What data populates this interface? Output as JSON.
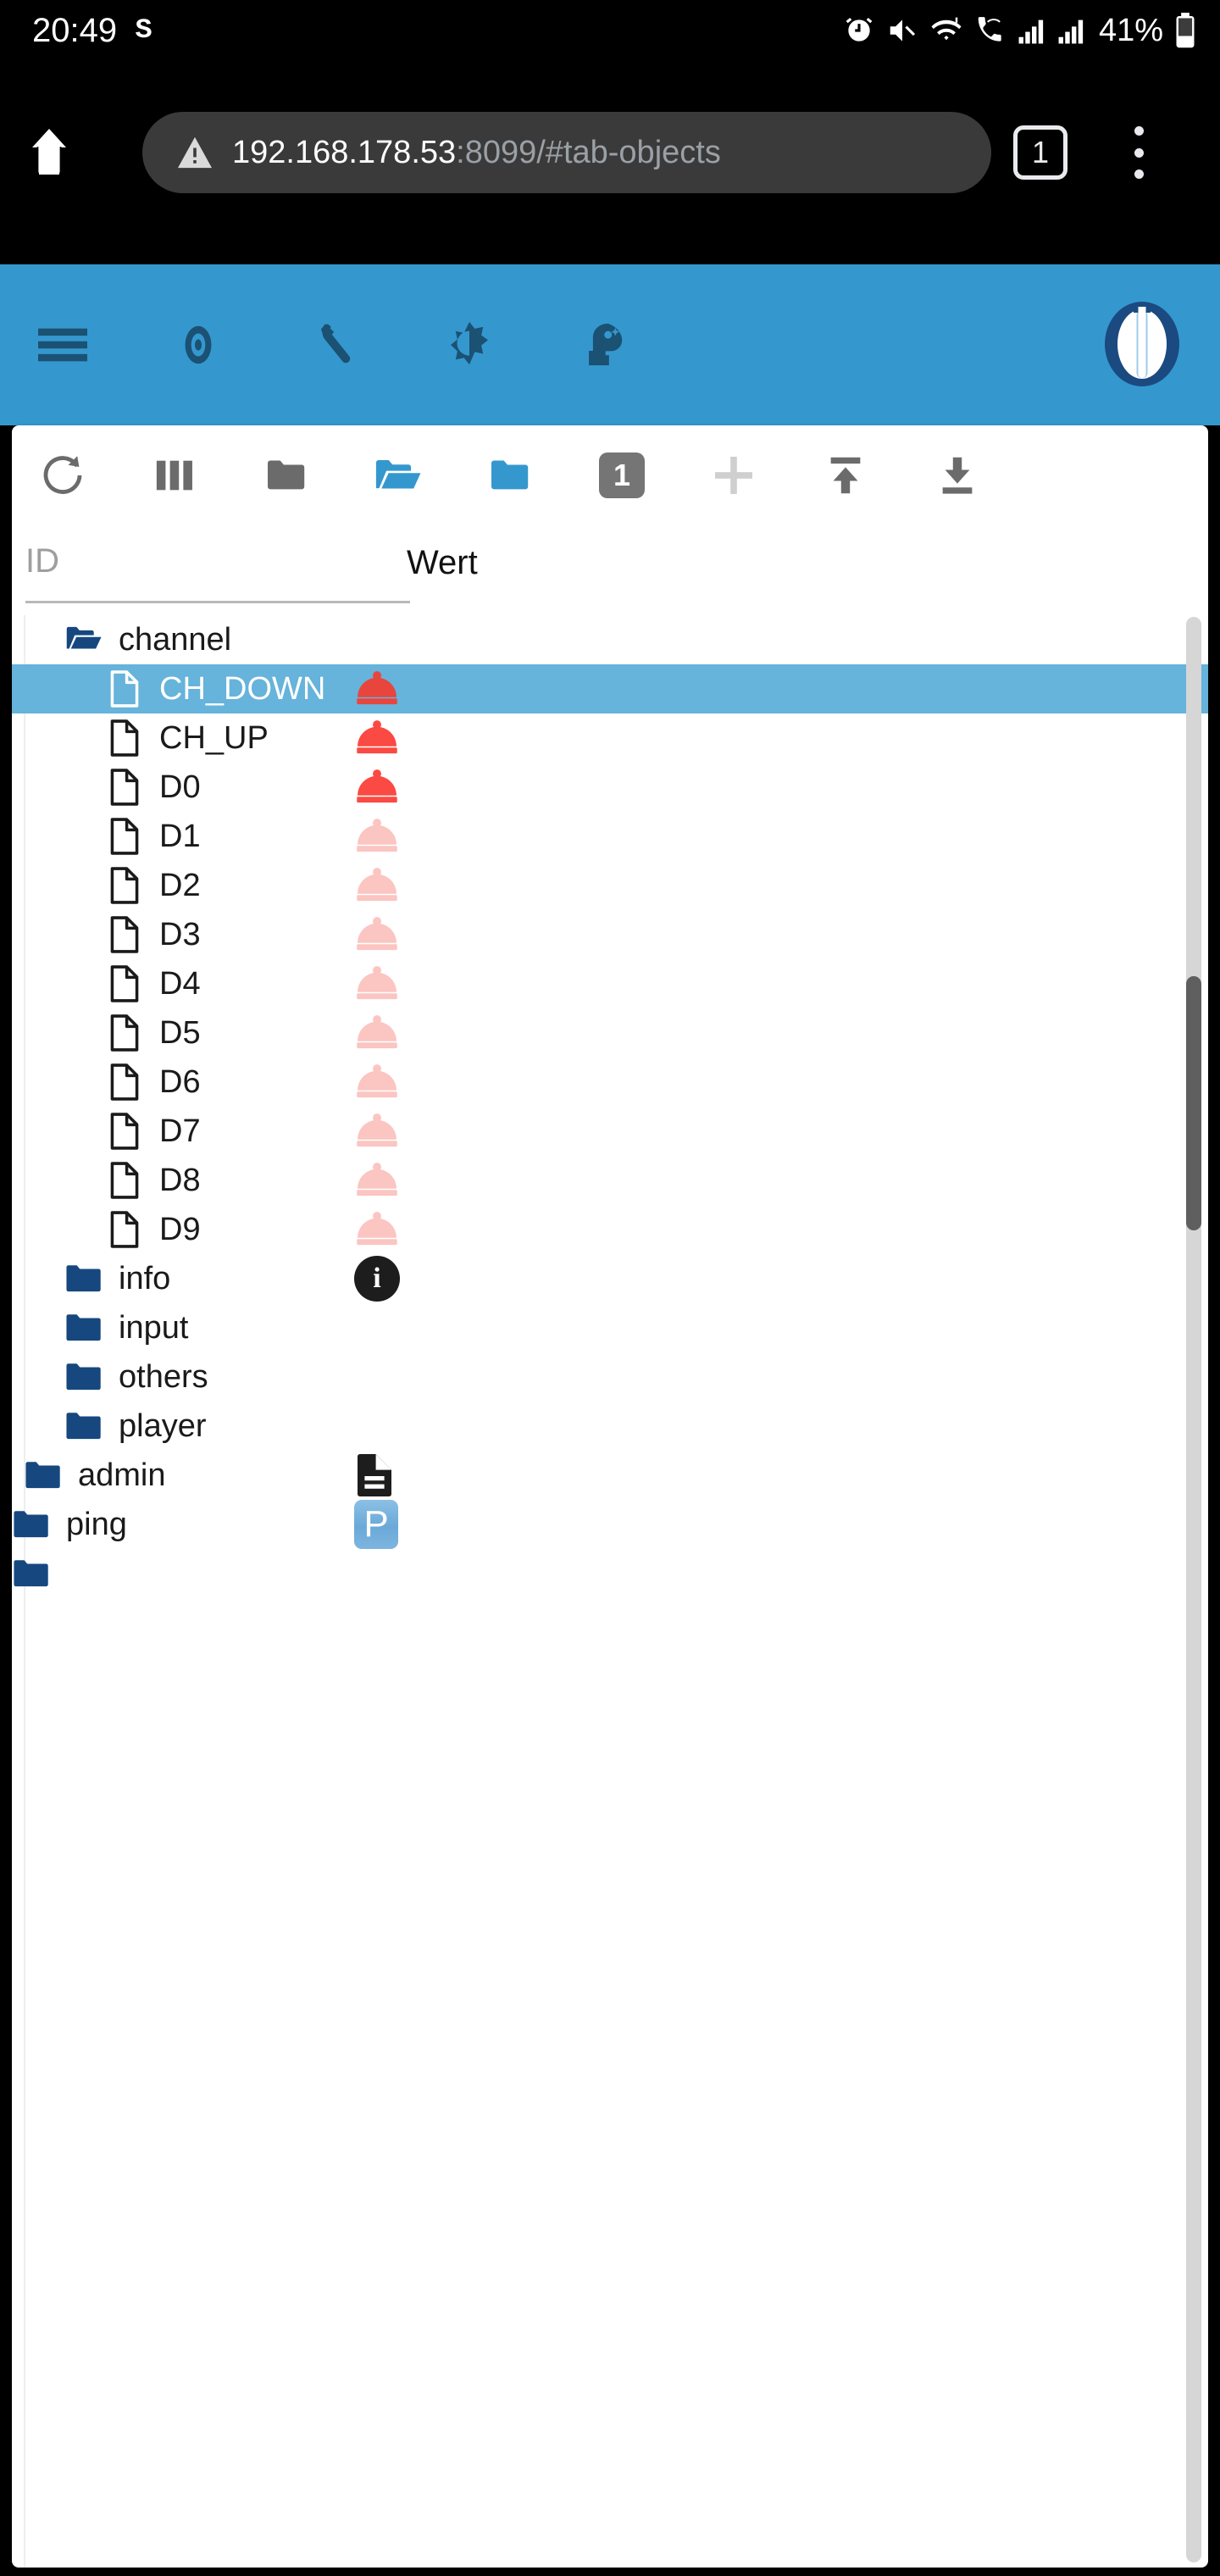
{
  "status_bar": {
    "time": "20:49",
    "snapchat_label": "S",
    "battery_percent": "41%",
    "icons": [
      "alarm-icon",
      "mute-icon",
      "wifi-icon",
      "wifi-call-icon",
      "signal-sim1-icon",
      "signal-sim2-icon",
      "battery-icon"
    ]
  },
  "browser": {
    "home_icon": "home-icon",
    "security_icon": "warning-triangle-icon",
    "url_host": "192.168.178.53",
    "url_rest": ":8099/#tab-objects",
    "tab_count": "1",
    "menu_icon": "kebab-menu-icon"
  },
  "app_header": {
    "background": "#3498cf",
    "icons": [
      {
        "name": "hamburger-menu-icon",
        "label": "Menu"
      },
      {
        "name": "eye-icon",
        "label": "Show/Hide"
      },
      {
        "name": "wrench-icon",
        "label": "Settings"
      },
      {
        "name": "contrast-icon",
        "label": "Theme"
      },
      {
        "name": "expert-mode-icon",
        "label": "Expert mode"
      }
    ],
    "logo_name": "iobroker-logo"
  },
  "toolbar": {
    "buttons": [
      {
        "name": "refresh-button",
        "icon": "refresh-icon"
      },
      {
        "name": "columns-button",
        "icon": "columns-icon"
      },
      {
        "name": "collapse-all-button",
        "icon": "folder-gray-icon"
      },
      {
        "name": "expand-all-button",
        "icon": "folder-open-blue-icon"
      },
      {
        "name": "collapse-one-button",
        "icon": "folder-blue-icon"
      },
      {
        "name": "depth-badge",
        "icon": "depth-number-badge",
        "value": "1"
      },
      {
        "name": "add-object-button",
        "icon": "plus-icon"
      },
      {
        "name": "import-button",
        "icon": "upload-arrow-icon"
      },
      {
        "name": "export-button",
        "icon": "download-arrow-icon"
      }
    ]
  },
  "table": {
    "id_filter_placeholder": "ID",
    "value_column_header": "Wert",
    "selected_row_color": "#66b3db",
    "rows": [
      {
        "id": "r1",
        "label": "channel",
        "icon": "folder-open-navy-icon",
        "indent": 1,
        "value_icon": "none",
        "selected": false
      },
      {
        "id": "r2",
        "label": "CH_DOWN",
        "icon": "file-outline-white-icon",
        "indent": 2,
        "value_icon": "dome-red-icon",
        "selected": true
      },
      {
        "id": "r3",
        "label": "CH_UP",
        "icon": "file-outline-icon",
        "indent": 2,
        "value_icon": "dome-red-icon",
        "selected": false
      },
      {
        "id": "r4",
        "label": "D0",
        "icon": "file-outline-icon",
        "indent": 2,
        "value_icon": "dome-red-icon",
        "selected": false
      },
      {
        "id": "r5",
        "label": "D1",
        "icon": "file-outline-icon",
        "indent": 2,
        "value_icon": "dome-pale-icon",
        "selected": false
      },
      {
        "id": "r6",
        "label": "D2",
        "icon": "file-outline-icon",
        "indent": 2,
        "value_icon": "dome-pale-icon",
        "selected": false
      },
      {
        "id": "r7",
        "label": "D3",
        "icon": "file-outline-icon",
        "indent": 2,
        "value_icon": "dome-pale-icon",
        "selected": false
      },
      {
        "id": "r8",
        "label": "D4",
        "icon": "file-outline-icon",
        "indent": 2,
        "value_icon": "dome-pale-icon",
        "selected": false
      },
      {
        "id": "r9",
        "label": "D5",
        "icon": "file-outline-icon",
        "indent": 2,
        "value_icon": "dome-pale-icon",
        "selected": false
      },
      {
        "id": "r10",
        "label": "D6",
        "icon": "file-outline-icon",
        "indent": 2,
        "value_icon": "dome-pale-icon",
        "selected": false
      },
      {
        "id": "r11",
        "label": "D7",
        "icon": "file-outline-icon",
        "indent": 2,
        "value_icon": "dome-pale-icon",
        "selected": false
      },
      {
        "id": "r12",
        "label": "D8",
        "icon": "file-outline-icon",
        "indent": 2,
        "value_icon": "dome-pale-icon",
        "selected": false
      },
      {
        "id": "r13",
        "label": "D9",
        "icon": "file-outline-icon",
        "indent": 2,
        "value_icon": "dome-pale-icon",
        "selected": false
      },
      {
        "id": "r14",
        "label": "info",
        "icon": "folder-navy-icon",
        "indent": 1,
        "value_icon": "info-badge-icon",
        "selected": false
      },
      {
        "id": "r15",
        "label": "input",
        "icon": "folder-navy-icon",
        "indent": 1,
        "value_icon": "none",
        "selected": false
      },
      {
        "id": "r16",
        "label": "others",
        "icon": "folder-navy-icon",
        "indent": 1,
        "value_icon": "none",
        "selected": false
      },
      {
        "id": "r17",
        "label": "player",
        "icon": "folder-navy-icon",
        "indent": 1,
        "value_icon": "none",
        "selected": false
      },
      {
        "id": "r18",
        "label": "admin",
        "icon": "folder-navy-icon",
        "indent": 0,
        "value_icon": "doc-black-icon",
        "selected": false
      },
      {
        "id": "r19",
        "label": "ping",
        "icon": "folder-navy-icon",
        "indent": -1,
        "value_icon": "p-badge-icon",
        "selected": false
      }
    ],
    "info_badge_letter": "i",
    "p_badge_letter": "P"
  },
  "scrollbar": {
    "name": "vertical-scrollbar"
  }
}
